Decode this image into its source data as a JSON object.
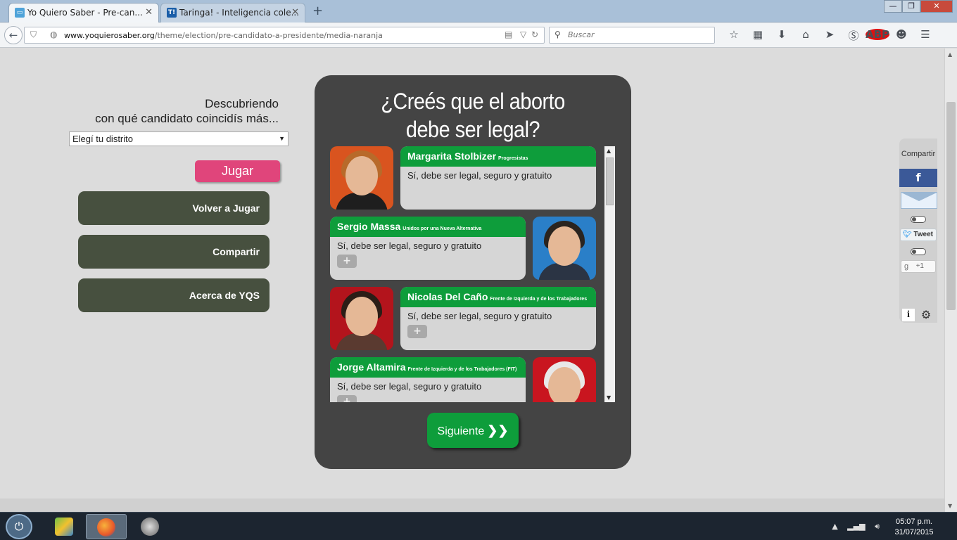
{
  "browser": {
    "tabs": [
      {
        "title": "Yo Quiero Saber - Pre-can...",
        "favicon": "yqs-favicon",
        "color": "#4fa3d9"
      },
      {
        "title": "Taringa! - Inteligencia cole...",
        "favicon_text": "T!",
        "color": "#1a5ea8"
      }
    ],
    "new_tab": "+",
    "window_buttons": {
      "minimize": "—",
      "maximize": "❐",
      "close": "✕"
    },
    "url_domain": "www.yoquierosaber.org",
    "url_path": "/theme/election/pre-candidato-a-presidente/media-naranja",
    "search_placeholder": "Buscar",
    "toolbar_icons": [
      "star-icon",
      "reading-list-icon",
      "download-icon",
      "home-icon",
      "send-icon",
      "s-icon",
      "adblock-plus-icon",
      "smiley-icon",
      "menu-icon"
    ],
    "abp_label": "ABP"
  },
  "left": {
    "heading_line1": "Descubriendo",
    "heading_line2": "con qué candidato coincidís más...",
    "district_selected": "Elegí tu distrito",
    "jugar_label": "Jugar",
    "buttons": [
      "Volver a Jugar",
      "Compartir",
      "Acerca de YQS"
    ]
  },
  "question": {
    "line1": "¿Creés que el aborto",
    "line2": "debe ser legal?"
  },
  "answers": [
    {
      "name": "Margarita Stolbizer",
      "party": "Progresistas",
      "answer": "Sí, debe ser legal, seguro y gratuito",
      "side": "photo-left",
      "photo_bg": "#d9541f",
      "has_more": false
    },
    {
      "name": "Sergio Massa",
      "party": "Unidos por una Nueva Alternativa",
      "answer": "Sí, debe ser legal, seguro y gratuito",
      "side": "photo-right",
      "photo_bg": "#2a7fc8",
      "has_more": true
    },
    {
      "name": "Nicolas Del Caño",
      "party": "Frente de Izquierda y de los Trabajadores",
      "answer": "Sí, debe ser legal, seguro y gratuito",
      "side": "photo-left",
      "photo_bg": "#b3141c",
      "has_more": true
    },
    {
      "name": "Jorge Altamira",
      "party": "Frente de Izquierda y de los Trabajadores (FIT)",
      "answer": "Sí, debe ser legal, seguro y gratuito",
      "side": "photo-right",
      "photo_bg": "#c9151f",
      "has_more": true
    }
  ],
  "more_label": "+",
  "next_label": "Siguiente",
  "next_chevron": "❯❯",
  "share": {
    "label": "Compartir",
    "facebook": "f",
    "tweet": "Tweet",
    "gplus": "+1",
    "gplus_g": "g",
    "info": "i",
    "gear": "⚙"
  },
  "taskbar": {
    "time": "05:07 p.m.",
    "date": "31/07/2015",
    "tray_arrow": "▲"
  },
  "colors": {
    "accent_green": "#0e9d3b",
    "jugar_pink": "#e0457b",
    "side_button": "#47503f",
    "card_bg": "#444444"
  }
}
